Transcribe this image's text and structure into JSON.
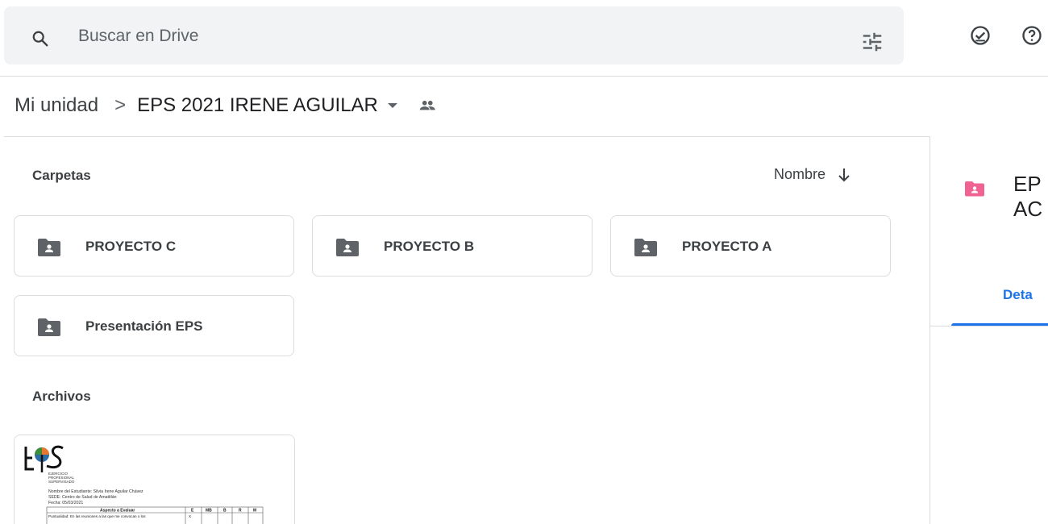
{
  "search": {
    "placeholder": "Buscar en Drive"
  },
  "breadcrumb": {
    "root": "Mi unidad",
    "separator": ">",
    "current": "EPS 2021 IRENE AGUILAR"
  },
  "sections": {
    "folders_label": "Carpetas",
    "files_label": "Archivos"
  },
  "sort": {
    "label": "Nombre",
    "direction": "descending"
  },
  "folders": [
    {
      "name": "PROYECTO C"
    },
    {
      "name": "PROYECTO B"
    },
    {
      "name": "PROYECTO A"
    },
    {
      "name": "Presentación EPS"
    }
  ],
  "file_preview": {
    "logo_text": "EPS",
    "logo_sub1": "EJERCICIO",
    "logo_sub2": "PROFESIONAL",
    "logo_sub3": "SUPERVISADO",
    "line1": "Nombre del Estudiante: Silvia Irene Aguilar Chávez",
    "line2": "SEDE: Centro de Salud de Amatitlán",
    "line3": "Fecha: 05/03/2021",
    "table_header": "Aspecto a Evaluar",
    "table_cols": [
      "E",
      "MB",
      "B",
      "R",
      "M"
    ],
    "row1": "Puntualidad: En las reuniones a las que me convocan o los",
    "row1_mark": "X"
  },
  "details_panel": {
    "title_line1": "EP",
    "title_line2": "AC",
    "tab_label": "Deta"
  },
  "colors": {
    "accent": "#1a73e8",
    "folder_icon": "#5f6368",
    "shared_folder_pink": "#f06292",
    "search_bg": "#f1f3f4"
  },
  "icons": {
    "search": "search-icon",
    "tune": "tune-icon",
    "ready_offline": "offline-ready-icon",
    "help": "help-icon",
    "shared": "shared-people-icon",
    "sort_arrow": "arrow-down-icon",
    "folder": "shared-folder-icon"
  }
}
